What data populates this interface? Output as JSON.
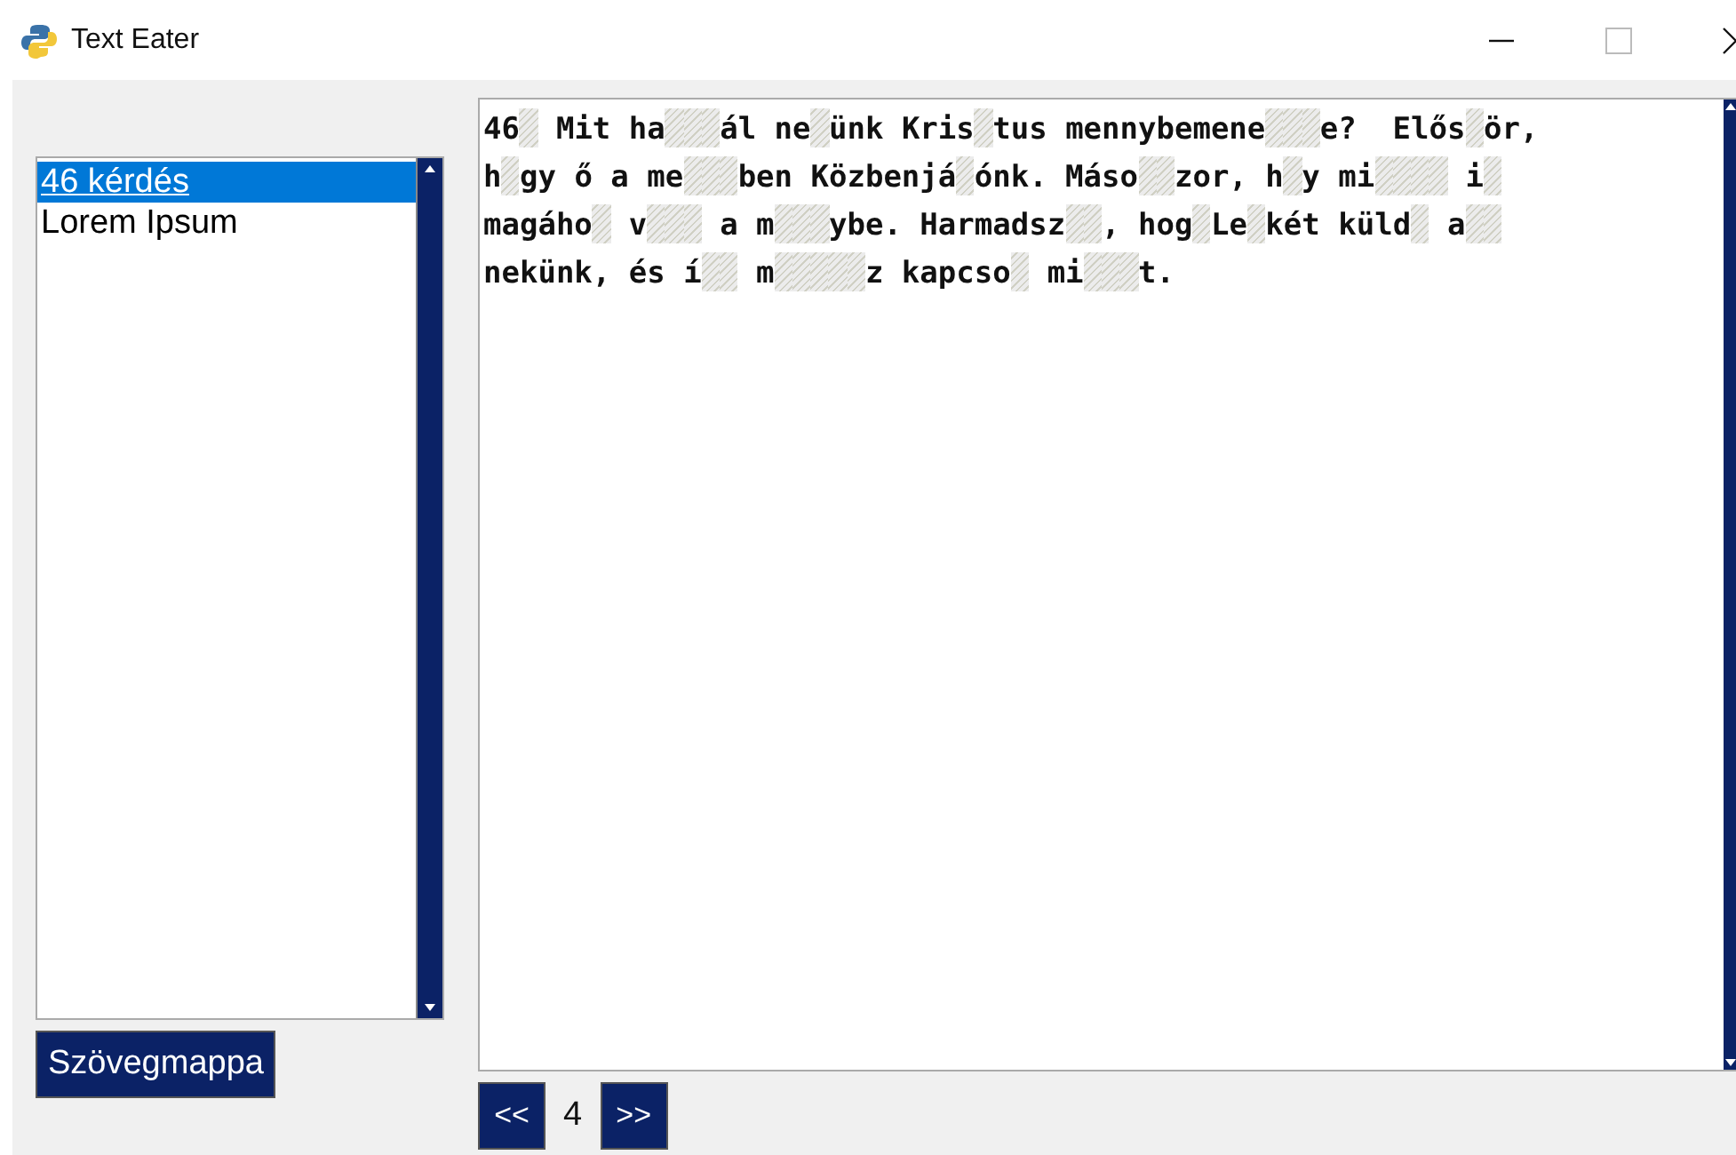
{
  "window": {
    "title": "Text Eater"
  },
  "list": {
    "items": [
      {
        "label": "46 kérdés",
        "selected": true
      },
      {
        "label": "Lorem Ipsum",
        "selected": false
      }
    ]
  },
  "folder_button": "Szövegmappa",
  "text_lines": [
    [
      {
        "kind": "text",
        "text": "46"
      },
      {
        "kind": "gap"
      },
      {
        "kind": "text",
        "text": " Mit ha"
      },
      {
        "kind": "gap"
      },
      {
        "kind": "gap"
      },
      {
        "kind": "gap"
      },
      {
        "kind": "text",
        "text": "ál ne"
      },
      {
        "kind": "gap"
      },
      {
        "kind": "text",
        "text": "ünk Kris"
      },
      {
        "kind": "gap"
      },
      {
        "kind": "text",
        "text": "tus mennybemene"
      },
      {
        "kind": "gap"
      },
      {
        "kind": "gap"
      },
      {
        "kind": "gap"
      },
      {
        "kind": "text",
        "text": "e?  Elős"
      },
      {
        "kind": "gap"
      },
      {
        "kind": "text",
        "text": "ör,"
      }
    ],
    [
      {
        "kind": "text",
        "text": "h"
      },
      {
        "kind": "gap"
      },
      {
        "kind": "text",
        "text": "gy ő a me"
      },
      {
        "kind": "gap"
      },
      {
        "kind": "gap"
      },
      {
        "kind": "gap"
      },
      {
        "kind": "text",
        "text": "ben Közbenjá"
      },
      {
        "kind": "gap"
      },
      {
        "kind": "text",
        "text": "ónk. Máso"
      },
      {
        "kind": "gap"
      },
      {
        "kind": "gap"
      },
      {
        "kind": "text",
        "text": "zor, h"
      },
      {
        "kind": "gap"
      },
      {
        "kind": "text",
        "text": "y mi"
      },
      {
        "kind": "gap"
      },
      {
        "kind": "gap"
      },
      {
        "kind": "gap"
      },
      {
        "kind": "gap"
      },
      {
        "kind": "text",
        "text": " i"
      },
      {
        "kind": "gap"
      }
    ],
    [
      {
        "kind": "text",
        "text": "magáho"
      },
      {
        "kind": "gap"
      },
      {
        "kind": "text",
        "text": " v"
      },
      {
        "kind": "gap"
      },
      {
        "kind": "gap"
      },
      {
        "kind": "gap"
      },
      {
        "kind": "text",
        "text": " a m"
      },
      {
        "kind": "gap"
      },
      {
        "kind": "gap"
      },
      {
        "kind": "gap"
      },
      {
        "kind": "text",
        "text": "ybe. Harmadsz"
      },
      {
        "kind": "gap"
      },
      {
        "kind": "gap"
      },
      {
        "kind": "text",
        "text": ", hog"
      },
      {
        "kind": "gap"
      },
      {
        "kind": "text",
        "text": "Le"
      },
      {
        "kind": "gap"
      },
      {
        "kind": "text",
        "text": "két küld"
      },
      {
        "kind": "gap"
      },
      {
        "kind": "text",
        "text": " a"
      },
      {
        "kind": "gap"
      },
      {
        "kind": "gap"
      }
    ],
    [
      {
        "kind": "text",
        "text": "nekünk, és í"
      },
      {
        "kind": "gap"
      },
      {
        "kind": "gap"
      },
      {
        "kind": "text",
        "text": " m"
      },
      {
        "kind": "gap"
      },
      {
        "kind": "gap"
      },
      {
        "kind": "gap"
      },
      {
        "kind": "gap"
      },
      {
        "kind": "gap"
      },
      {
        "kind": "text",
        "text": "z kapcso"
      },
      {
        "kind": "gap"
      },
      {
        "kind": "text",
        "text": " mi"
      },
      {
        "kind": "gap"
      },
      {
        "kind": "gap"
      },
      {
        "kind": "gap"
      },
      {
        "kind": "text",
        "text": "t."
      }
    ]
  ],
  "pager": {
    "prev": "<<",
    "page": "4",
    "next": ">>"
  }
}
